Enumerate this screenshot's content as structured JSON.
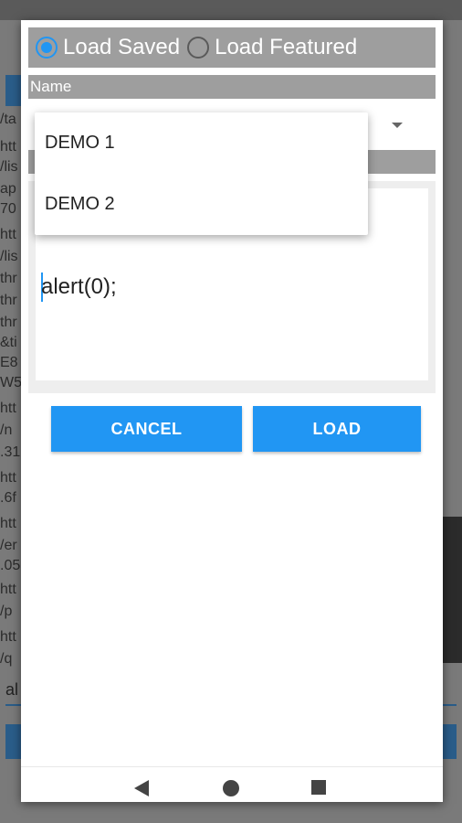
{
  "background": {
    "fragments": [
      "/ta",
      "htt",
      "/lis",
      "ap",
      "70",
      "htt",
      "/lis",
      "thr",
      "thr",
      "thr",
      "&ti",
      "E8",
      "W5",
      "htt",
      "/n",
      ".31",
      "htt",
      ".6f",
      "htt",
      "/er",
      ".05",
      "htt",
      "/p",
      "htt",
      "/q"
    ],
    "input_value": "al"
  },
  "dialog": {
    "radio": {
      "options": [
        {
          "label": "Load Saved",
          "checked": true
        },
        {
          "label": "Load Featured",
          "checked": false
        }
      ]
    },
    "name_label": "Name",
    "dropdown_items": [
      "DEMO 1",
      "DEMO 2"
    ],
    "code_value": "alert(0);",
    "buttons": {
      "cancel": "CANCEL",
      "load": "LOAD"
    }
  },
  "colors": {
    "accent": "#2196f3",
    "section_bar": "#9e9e9e"
  },
  "icons": {
    "nav": [
      "back-icon",
      "home-icon",
      "recents-icon"
    ],
    "spinner": "dropdown-arrow-icon"
  }
}
